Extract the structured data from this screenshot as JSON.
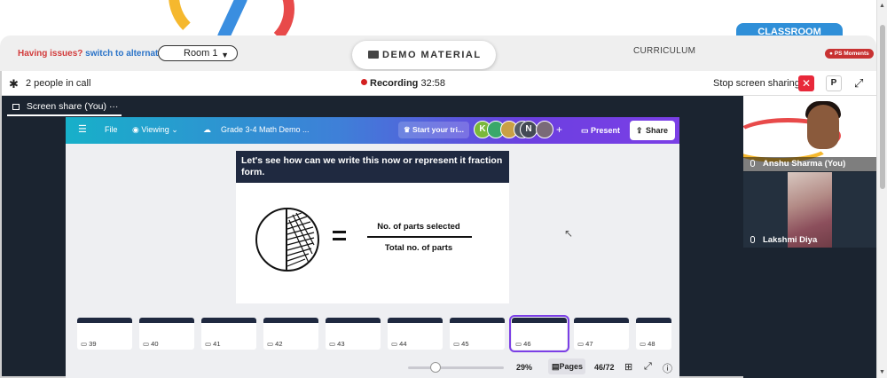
{
  "header": {
    "issues_text": "Having issues?",
    "alternate_link": "switch to alternate room",
    "room_value": "Room 1",
    "demo_button": "DEMO MATERIAL",
    "curriculum_label": "CURRICULUM",
    "classroom_tab": "CLASSROOM",
    "ps_moments": "PS Moments"
  },
  "callbar": {
    "people": "2 people in call",
    "recording_label": "Recording",
    "recording_time": "32:58",
    "stop_sharing": "Stop screen sharing",
    "p_button": "P"
  },
  "share_tab": {
    "label": "Screen share (You)",
    "more": "···"
  },
  "canva": {
    "file": "File",
    "viewing": "Viewing",
    "doc_title": "Grade 3-4 Math Demo ...",
    "start_trial": "Start your tri...",
    "avatars": [
      "K",
      "N"
    ],
    "add": "+",
    "present": "Present",
    "share": "Share"
  },
  "slide": {
    "heading": "Let's see how can we write this now or represent it fraction form.",
    "numerator": "No. of parts selected",
    "denominator": "Total no. of parts"
  },
  "thumbnails": [
    {
      "num": "39"
    },
    {
      "num": "40"
    },
    {
      "num": "41"
    },
    {
      "num": "42"
    },
    {
      "num": "43"
    },
    {
      "num": "44"
    },
    {
      "num": "45"
    },
    {
      "num": "46",
      "selected": true
    },
    {
      "num": "47"
    },
    {
      "num": "48"
    }
  ],
  "bottom": {
    "zoom_percent": 29,
    "zoom": "29%",
    "pages": "Pages",
    "page_index": "46/72"
  },
  "participants": [
    {
      "name": "Anshu Sharma (You)"
    },
    {
      "name": "Lakshmi Diya"
    }
  ],
  "colors": {
    "recording_dot": "#d32020",
    "stop_button": "#e8283a",
    "canva_gradient_start": "#17b0c9",
    "canva_gradient_end": "#7b3fe6",
    "classroom_tab": "#2f8fd8"
  }
}
